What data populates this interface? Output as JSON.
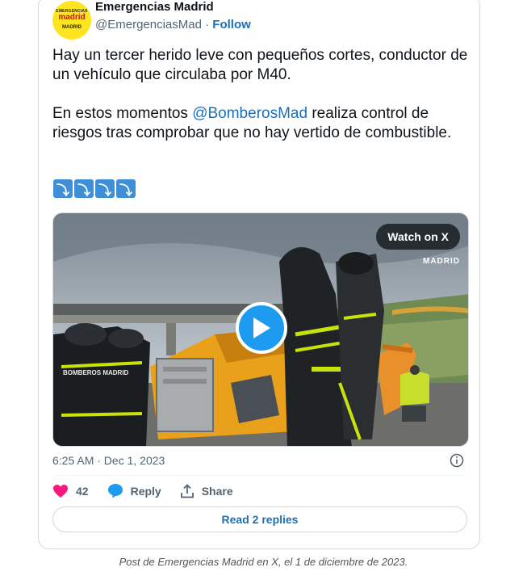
{
  "account": {
    "name": "Emergencias Madrid",
    "handle": "@EmergenciasMad",
    "separator": "·",
    "follow_label": "Follow",
    "avatar_text": [
      "EMERGENCIAS",
      "madrid",
      "MADRID"
    ]
  },
  "tweet": {
    "paragraph1": "Hay un tercer herido leve con pequeños cortes, conductor de un vehículo que circulaba por M40.",
    "paragraph2_before": "En estos momentos ",
    "mention": "@BomberosMad",
    "paragraph2_after": " realiza control de riesgos tras comprobar que no hay vertido de combustible.",
    "emoji_glyph": "⤵",
    "emoji_count": 4
  },
  "media": {
    "watch_label": "Watch on X",
    "brand_watermark": "MADRID",
    "jacket_text": "BOMBEROS MADRID",
    "sky_color": "#9aa4ae",
    "truck_color": "#e9a01a"
  },
  "meta": {
    "timestamp": "6:25 AM · Dec 1, 2023"
  },
  "actions": {
    "likes": "42",
    "reply_label": "Reply",
    "share_label": "Share",
    "like_color": "#f91880",
    "reply_color": "#1d9bf0"
  },
  "replies_button": "Read 2 replies",
  "caption": "Post de Emergencias Madrid en X, el 1 de diciembre de 2023."
}
